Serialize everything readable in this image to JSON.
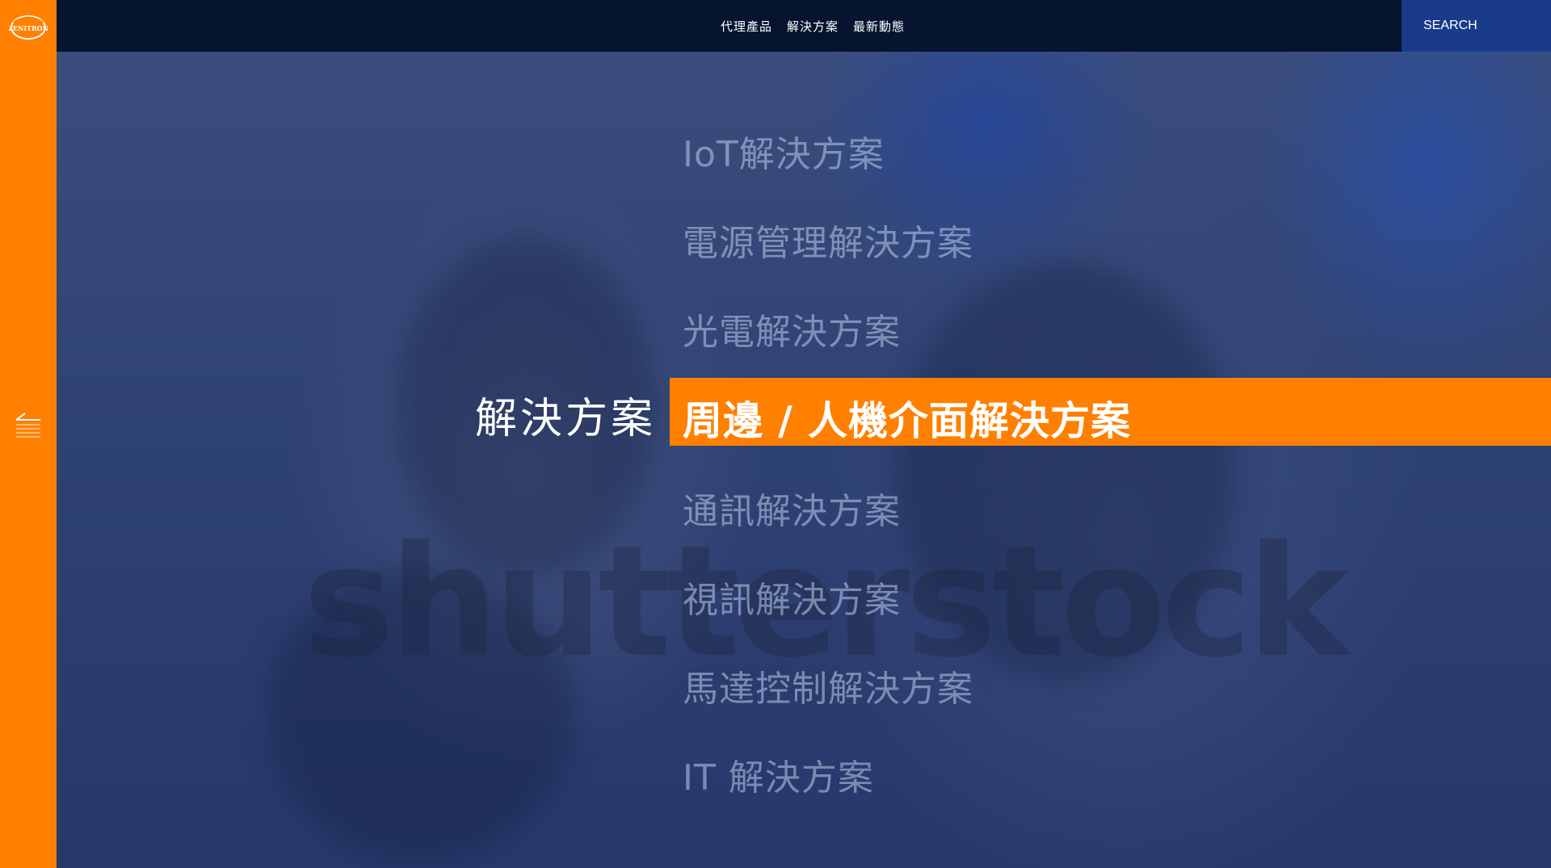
{
  "brand": {
    "logo_text": "ZENITRON",
    "accent_color": "#ff8000",
    "topbar_color": "#061430",
    "search_color": "#1a3b8c"
  },
  "nav": {
    "items": [
      {
        "label": "代理產品"
      },
      {
        "label": "解決方案"
      },
      {
        "label": "最新動態"
      }
    ]
  },
  "search": {
    "placeholder": "SEARCH",
    "icon": "search-icon"
  },
  "sidebar": {
    "toggle_icon": "menu-back-icon"
  },
  "solutions": {
    "section_title": "解決方案",
    "items": [
      {
        "label": "IoT解決方案",
        "active": false
      },
      {
        "label": "電源管理解決方案",
        "active": false
      },
      {
        "label": "光電解決方案",
        "active": false
      },
      {
        "label": "周邊 / 人機介面解決方案",
        "active": true
      },
      {
        "label": "通訊解決方案",
        "active": false
      },
      {
        "label": "視訊解決方案",
        "active": false
      },
      {
        "label": "馬達控制解決方案",
        "active": false
      },
      {
        "label": "IT 解決方案",
        "active": false
      }
    ]
  },
  "background": {
    "watermark": "shutterstock"
  }
}
